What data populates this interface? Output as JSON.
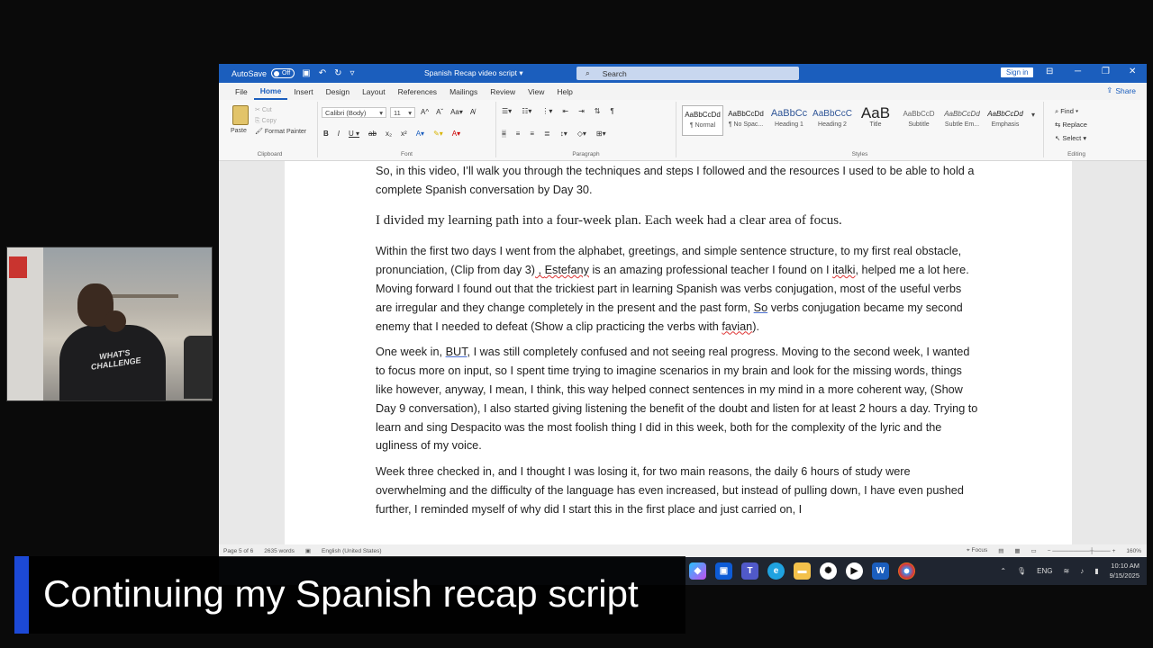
{
  "titlebar": {
    "autosave_label": "AutoSave",
    "autosave_state": "Off",
    "document_title": "Spanish Recap video script",
    "search_placeholder": "Search",
    "signin_label": "Sign in"
  },
  "tabs": [
    "File",
    "Home",
    "Insert",
    "Design",
    "Layout",
    "References",
    "Mailings",
    "Review",
    "View",
    "Help"
  ],
  "active_tab": "Home",
  "share_label": "Share",
  "ribbon": {
    "clipboard": {
      "paste": "Paste",
      "cut": "Cut",
      "copy": "Copy",
      "format_painter": "Format Painter",
      "label": "Clipboard"
    },
    "font": {
      "family": "Calibri (Body)",
      "size": "11",
      "label": "Font"
    },
    "paragraph": {
      "label": "Paragraph"
    },
    "styles": {
      "label": "Styles",
      "items": [
        {
          "sample": "AaBbCcDd",
          "name": "¶ Normal"
        },
        {
          "sample": "AaBbCcDd",
          "name": "¶ No Spac..."
        },
        {
          "sample": "AaBbCc",
          "name": "Heading 1"
        },
        {
          "sample": "AaBbCcC",
          "name": "Heading 2"
        },
        {
          "sample": "AaB",
          "name": "Title"
        },
        {
          "sample": "AaBbCcD",
          "name": "Subtitle"
        },
        {
          "sample": "AaBbCcDd",
          "name": "Subtle Em..."
        },
        {
          "sample": "AaBbCcDd",
          "name": "Emphasis"
        }
      ]
    },
    "editing": {
      "find": "Find",
      "replace": "Replace",
      "select": "Select",
      "label": "Editing"
    }
  },
  "document": {
    "p1": "So, in this video, I’ll walk you through the techniques and steps I followed and the resources I used to be able to hold a complete Spanish conversation by Day 30.",
    "heading": "I divided my learning path into a four-week plan. Each week had a clear area of focus.",
    "p2_a": "Within the first two days I went from the alphabet, greetings, and simple sentence structure, to my first real obstacle, pronunciation, (Clip from day 3)",
    "p2_b": " , ",
    "p2_c": "Estefany",
    "p2_d": " is an amazing professional teacher I found on I ",
    "p2_e": "italki",
    "p2_f": ", helped me a lot here. Moving forward I found out that the trickiest part in learning Spanish was verbs conjugation, most of the useful verbs are irregular and they change completely in the present and the past form, ",
    "p2_g": "So",
    "p2_h": " verbs conjugation became my second enemy that I needed to defeat (Show a clip practicing the verbs with ",
    "p2_i": "favian",
    "p2_j": ").",
    "p3_a": "One week in, ",
    "p3_b": "BUT",
    "p3_c": ", I was still completely confused and not seeing real progress. Moving to the second week, I wanted to focus more on input, so I spent time trying to imagine scenarios in my brain and look for the missing words, things like however, anyway, I mean, I think, this way helped connect sentences in my mind in a more coherent way, (Show Day 9 conversation), I also started giving listening the benefit of the doubt and listen for at least 2 hours a day. Trying to learn and sing Despacito was the most foolish thing I did in this week, both for the complexity of the lyric and the ugliness of my voice.",
    "p4": "Week three checked in, and I thought I was losing it, for two main reasons, the daily 6 hours of study were overwhelming and the difficulty of the language has even increased, but instead of pulling down, I have even pushed further, I reminded myself of why did I start this in the first place and just carried on, I"
  },
  "statusbar": {
    "page": "Page 5 of 6",
    "words": "2635 words",
    "language": "English (United States)",
    "focus": "Focus",
    "zoom": "160%"
  },
  "taskbar": {
    "lang": "ENG",
    "time": "10:10 AM",
    "date": "9/15/2025"
  },
  "webcam": {
    "shirt_text_1": "WHAT'S",
    "shirt_text_2": "CHALLENGE"
  },
  "caption": "Continuing my Spanish recap script",
  "colors": {
    "word_blue": "#1b5ebd",
    "caption_accent": "#1c49d6"
  }
}
